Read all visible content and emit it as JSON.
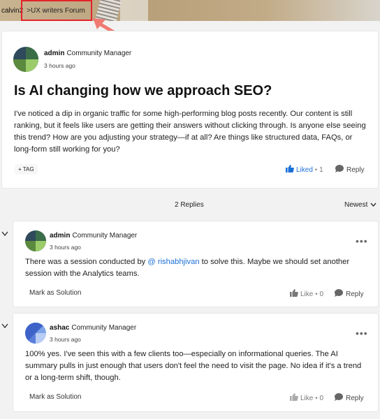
{
  "breadcrumb": {
    "home": "calvin2",
    "forum": "UX writers Forum"
  },
  "post": {
    "author": "admin",
    "role": "Community Manager",
    "time": "3 hours ago",
    "title": "Is AI changing how we approach SEO?",
    "body": "I've noticed a dip in organic traffic for some high-performing blog posts recently. Our content is still ranking, but it feels like users are getting their answers without clicking through. Is anyone else seeing this trend? How are you adjusting your strategy—if at all? Are things like structured data, FAQs, or long-form still working for you?",
    "tag_label": "+ TAG",
    "liked_label": "Liked",
    "like_count": "1",
    "reply_label": "Reply"
  },
  "replies_header": {
    "count_label": "2 Replies",
    "sort_label": "Newest"
  },
  "replies": [
    {
      "author": "admin",
      "role": "Community Manager",
      "time": "3 hours ago",
      "body_before": "There was a session conducted by ",
      "mention": "rishabhjivan",
      "body_after": " to solve this. Maybe we should set another session with the Analytics teams.",
      "mark_solution": "Mark as Solution",
      "like_label": "Like",
      "like_count": "0",
      "reply_label": "Reply"
    },
    {
      "author": "ashac",
      "role": "Community Manager",
      "time": "3 hours ago",
      "body": "100% yes. I've seen this with a few clients too—especially on informational queries. The AI summary pulls in just enough that users don't feel the need to visit the page. No idea if it's a trend or a long-term shift, though.",
      "mark_solution": "Mark as Solution",
      "like_label": "Like",
      "like_count": "0",
      "reply_label": "Reply"
    }
  ],
  "colors": {
    "accent": "#1a6fd6",
    "highlight_border": "#e2242a",
    "arrow": "#f07a72"
  }
}
